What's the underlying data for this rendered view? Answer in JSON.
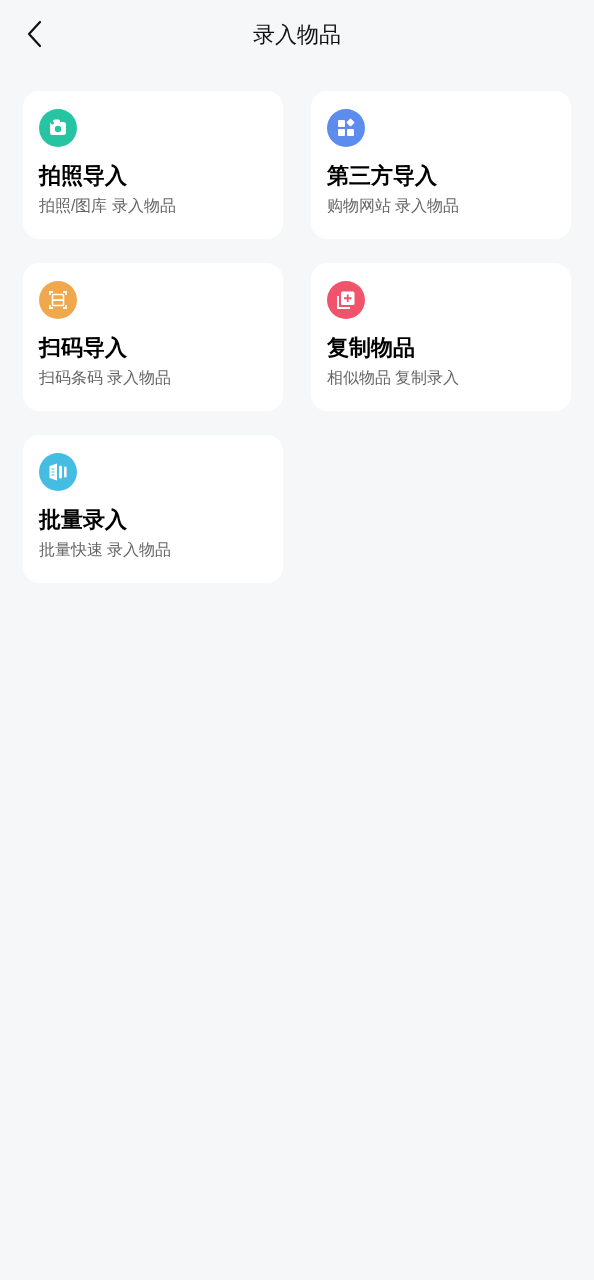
{
  "header": {
    "title": "录入物品"
  },
  "options": [
    {
      "kind": "camera",
      "color": "#27c4a4",
      "title": "拍照导入",
      "subtitle": "拍照/图库 录入物品"
    },
    {
      "kind": "apps",
      "color": "#5b8cee",
      "title": "第三方导入",
      "subtitle": "购物网站 录入物品"
    },
    {
      "kind": "scan",
      "color": "#f0a84c",
      "title": "扫码导入",
      "subtitle": "扫码条码 录入物品"
    },
    {
      "kind": "copy",
      "color": "#f0536b",
      "title": "复制物品",
      "subtitle": "相似物品 复制录入"
    },
    {
      "kind": "batch",
      "color": "#45bde2",
      "title": "批量录入",
      "subtitle": "批量快速 录入物品"
    }
  ]
}
